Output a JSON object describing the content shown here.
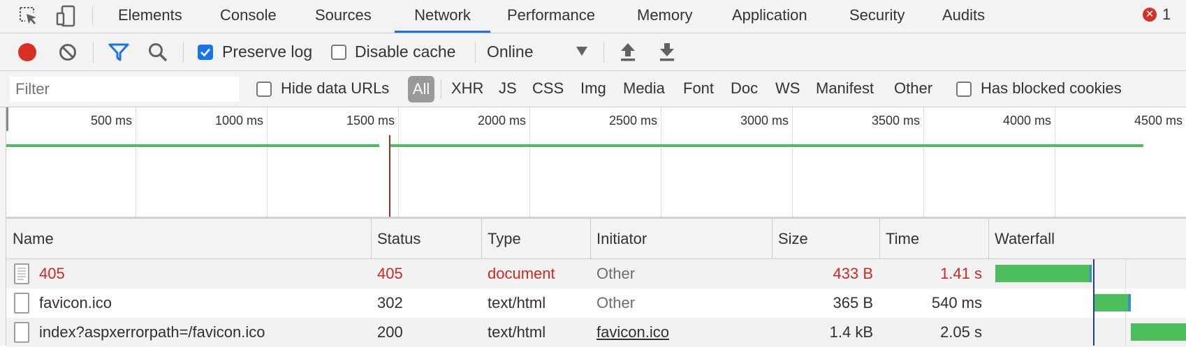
{
  "tabs": {
    "elements": "Elements",
    "console": "Console",
    "sources": "Sources",
    "network": "Network",
    "performance": "Performance",
    "memory": "Memory",
    "application": "Application",
    "security": "Security",
    "audits": "Audits",
    "error_count": "1"
  },
  "toolbar": {
    "preserve_log": "Preserve log",
    "preserve_log_checked": true,
    "disable_cache": "Disable cache",
    "disable_cache_checked": false,
    "throttle": "Online"
  },
  "filter": {
    "placeholder": "Filter",
    "hide_data_urls": "Hide data URLs",
    "types": [
      "All",
      "XHR",
      "JS",
      "CSS",
      "Img",
      "Media",
      "Font",
      "Doc",
      "WS",
      "Manifest",
      "Other"
    ],
    "active_type": "All",
    "has_blocked_cookies": "Has blocked cookies"
  },
  "overview": {
    "ticks": [
      "500 ms",
      "1000 ms",
      "1500 ms",
      "2000 ms",
      "2500 ms",
      "3000 ms",
      "3500 ms",
      "4000 ms",
      "4500 ms"
    ]
  },
  "table": {
    "columns": {
      "name": "Name",
      "status": "Status",
      "type": "Type",
      "initiator": "Initiator",
      "size": "Size",
      "time": "Time",
      "waterfall": "Waterfall"
    },
    "rows": [
      {
        "name": "405",
        "status": "405",
        "type": "document",
        "initiator": "Other",
        "size": "433 B",
        "time": "1.41 s"
      },
      {
        "name": "favicon.ico",
        "status": "302",
        "type": "text/html",
        "initiator": "Other",
        "size": "365 B",
        "time": "540 ms"
      },
      {
        "name": "index?aspxerrorpath=/favicon.ico",
        "status": "200",
        "type": "text/html",
        "initiator": "favicon.ico",
        "size": "1.4 kB",
        "time": "2.05 s"
      }
    ]
  },
  "colors": {
    "accent": "#1a73e8",
    "record": "#d93025",
    "error": "#d02a20",
    "bar_green": "#4cbf5c"
  }
}
